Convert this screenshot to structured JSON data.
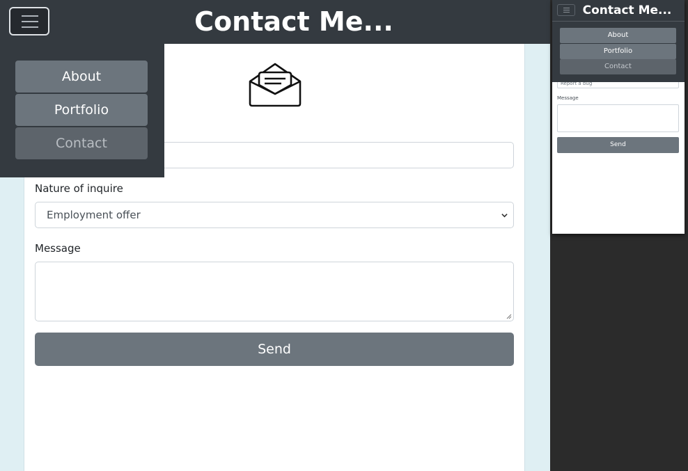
{
  "header": {
    "title": "Contact Me..."
  },
  "nav": {
    "items": [
      {
        "label": "About",
        "active": false
      },
      {
        "label": "Portfolio",
        "active": false
      },
      {
        "label": "Contact",
        "active": true
      }
    ]
  },
  "form": {
    "name_input_value": "",
    "inquiry_label": "Nature of inquire",
    "inquiry_selected": "Employment offer",
    "message_label": "Message",
    "message_value": "",
    "send_label": "Send"
  },
  "preview": {
    "title": "Contact Me...",
    "nav_items": [
      "About",
      "Portfolio",
      "Contact"
    ],
    "inquiry_selected": "Report a bug",
    "message_label": "Message",
    "send_label": "Send"
  },
  "colors": {
    "navbar_bg": "#343a40",
    "button_bg": "#6c757d",
    "page_bg": "#dfeff3"
  }
}
